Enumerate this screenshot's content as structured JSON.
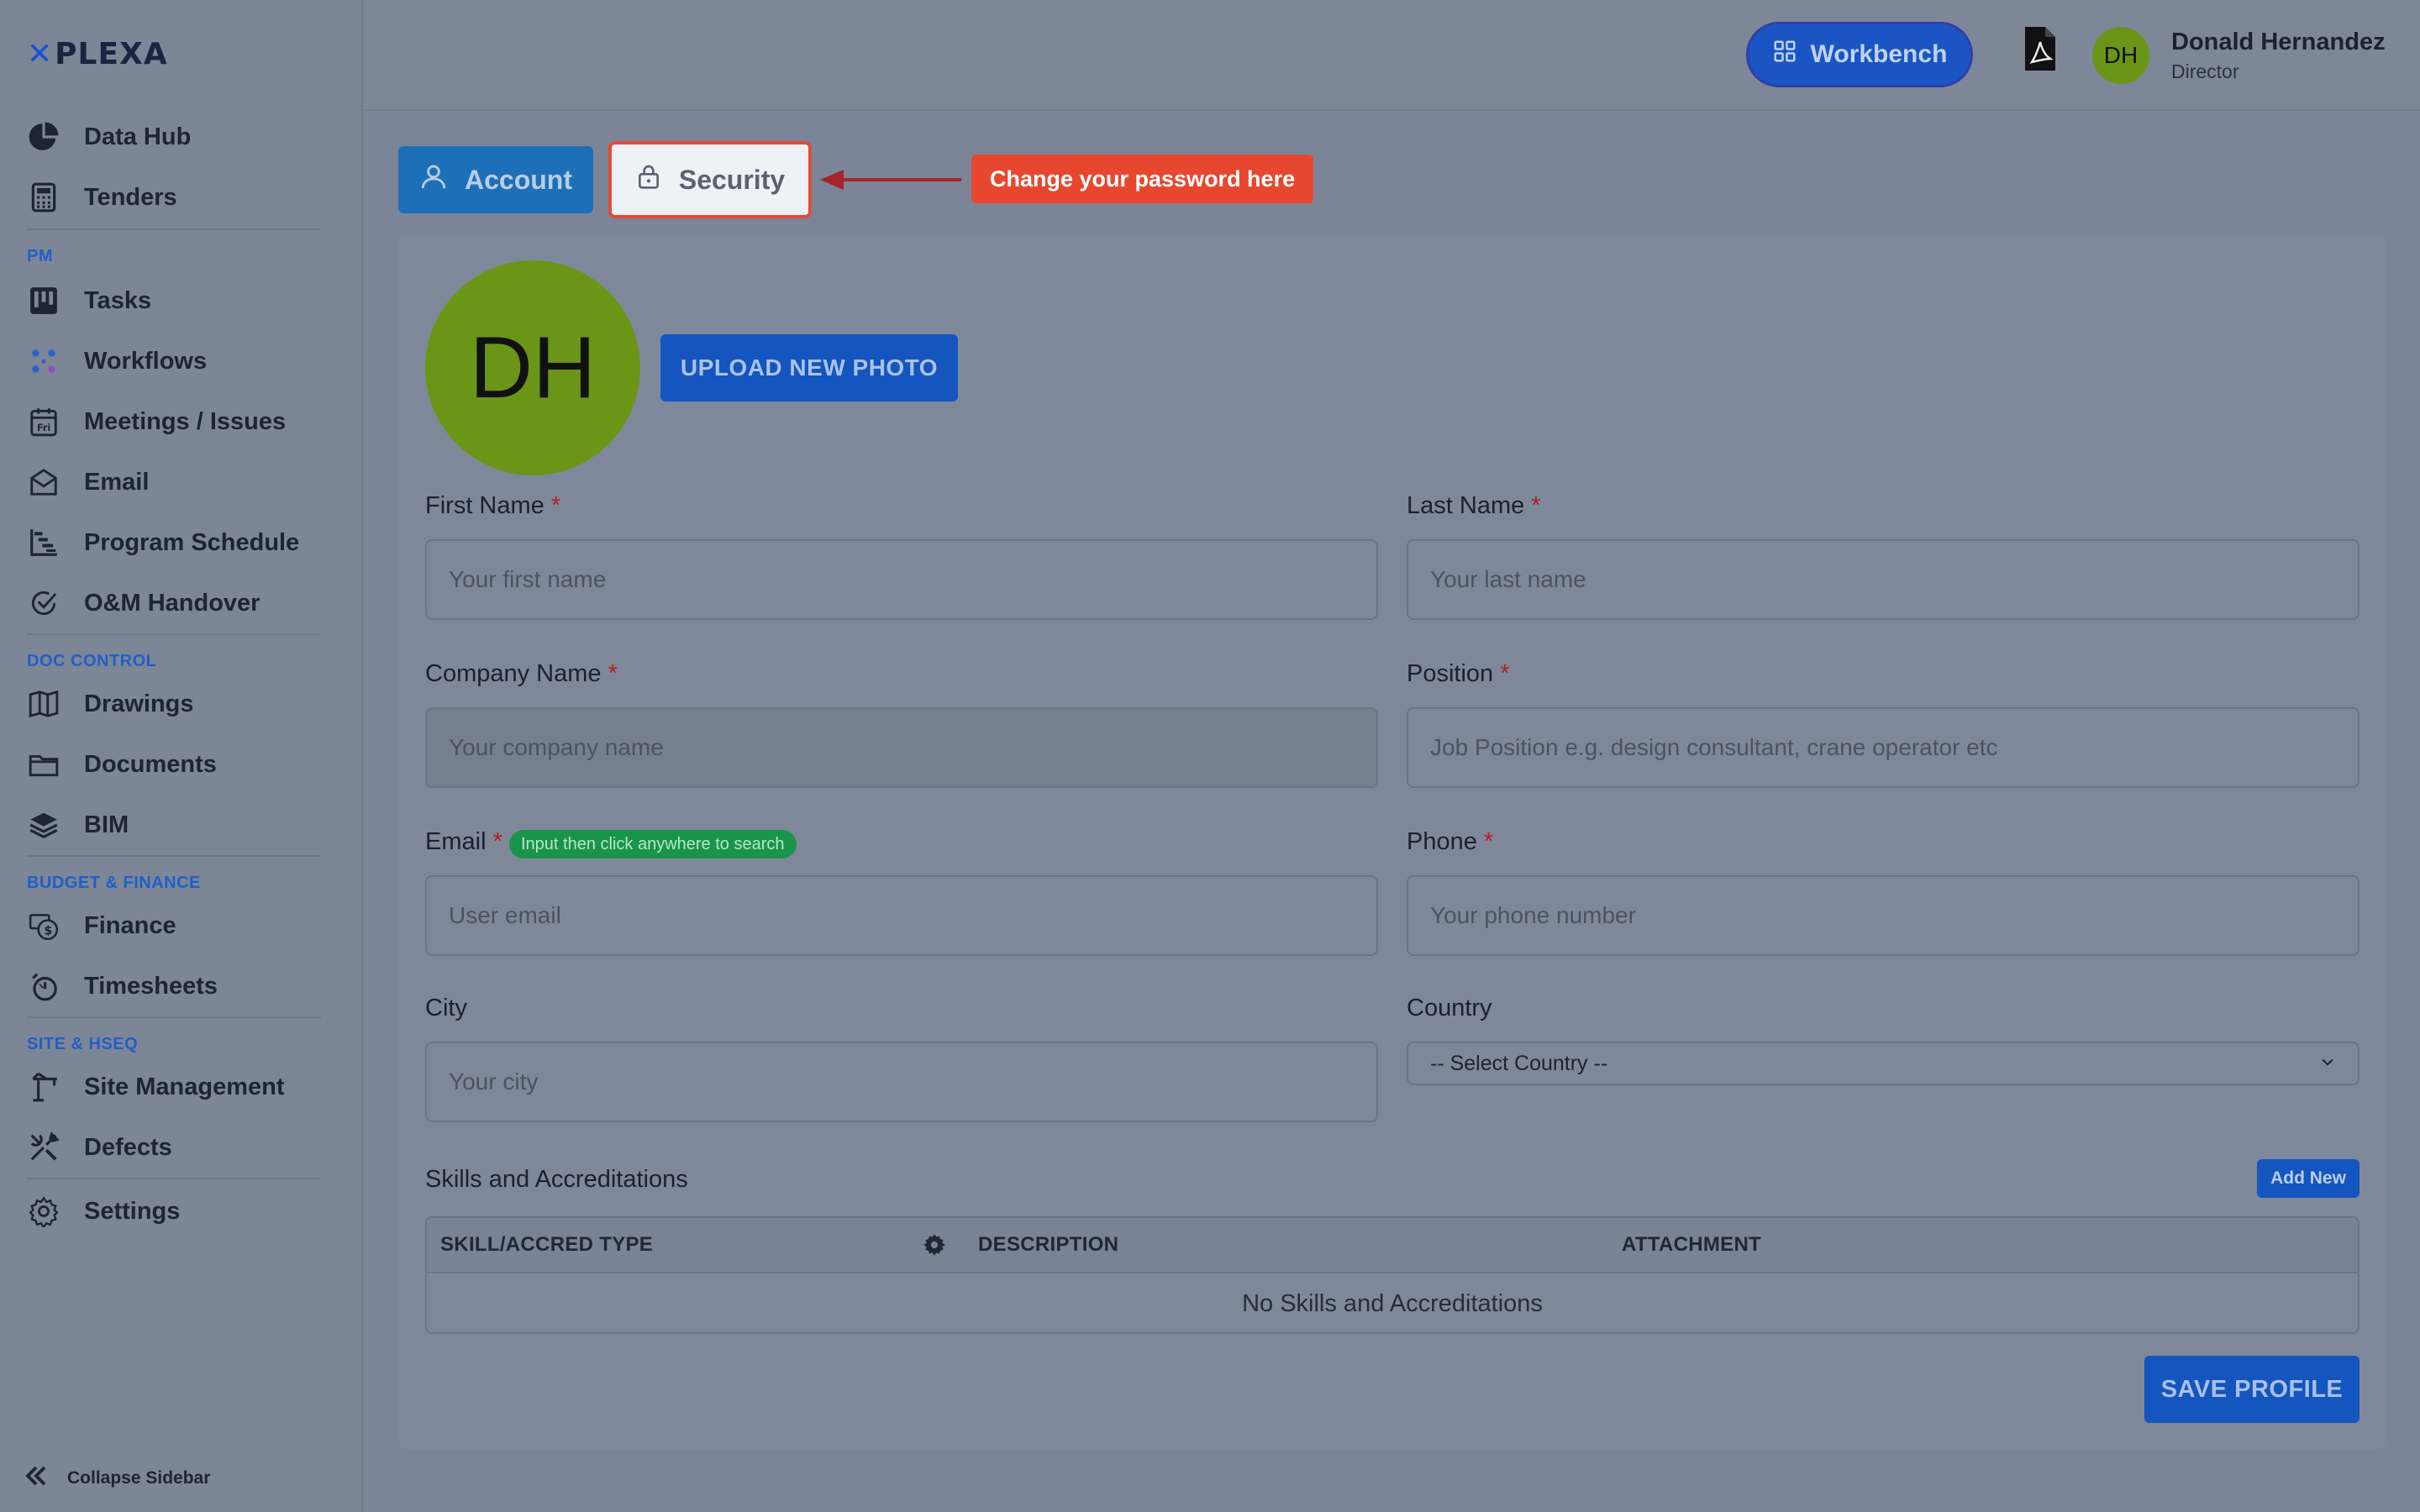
{
  "brand": {
    "logo_mark": "✕",
    "logo_text": "PLEXA"
  },
  "sidebar": {
    "items": [
      {
        "label": "Data Hub"
      },
      {
        "label": "Tenders"
      },
      {
        "label": "Tasks"
      },
      {
        "label": "Workflows"
      },
      {
        "label": "Meetings / Issues"
      },
      {
        "label": "Email"
      },
      {
        "label": "Program Schedule"
      },
      {
        "label": "O&M Handover"
      },
      {
        "label": "Drawings"
      },
      {
        "label": "Documents"
      },
      {
        "label": "BIM"
      },
      {
        "label": "Finance"
      },
      {
        "label": "Timesheets"
      },
      {
        "label": "Site Management"
      },
      {
        "label": "Defects"
      },
      {
        "label": "Settings"
      }
    ],
    "sections": {
      "pm": "PM",
      "doc_control": "DOC CONTROL",
      "budget": "BUDGET & FINANCE",
      "site": "SITE & HSEQ"
    },
    "collapse_label": "Collapse Sidebar"
  },
  "topbar": {
    "workbench_label": "Workbench",
    "user_initials": "DH",
    "user_name": "Donald Hernandez",
    "user_role": "Director"
  },
  "tabs": {
    "account_label": "Account",
    "security_label": "Security",
    "callout_text": "Change your password here"
  },
  "profile": {
    "avatar_initials": "DH",
    "upload_label": "UPLOAD NEW PHOTO",
    "fields": {
      "first_name": {
        "label": "First Name",
        "placeholder": "Your first name",
        "required": "*"
      },
      "last_name": {
        "label": "Last Name",
        "placeholder": "Your last name",
        "required": "*"
      },
      "company": {
        "label": "Company Name",
        "placeholder": "Your company name",
        "required": "*"
      },
      "position": {
        "label": "Position",
        "placeholder": "Job Position e.g. design consultant, crane operator etc",
        "required": "*"
      },
      "email": {
        "label": "Email",
        "placeholder": "User email",
        "required": "*",
        "hint": "Input then click anywhere to search"
      },
      "phone": {
        "label": "Phone",
        "placeholder": "Your phone number",
        "required": "*"
      },
      "city": {
        "label": "City",
        "placeholder": "Your city"
      },
      "country": {
        "label": "Country",
        "selected": "-- Select Country --"
      }
    },
    "skills": {
      "title": "Skills and Accreditations",
      "add_label": "Add New",
      "columns": [
        "SKILL/ACCRED TYPE",
        "DESCRIPTION",
        "ATTACHMENT"
      ],
      "empty_text": "No Skills and Accreditations"
    },
    "save_label": "SAVE PROFILE"
  },
  "colors": {
    "accent": "#1455bf",
    "callout": "#e8472f",
    "avatar": "#6b9517",
    "hint": "#19944a"
  }
}
